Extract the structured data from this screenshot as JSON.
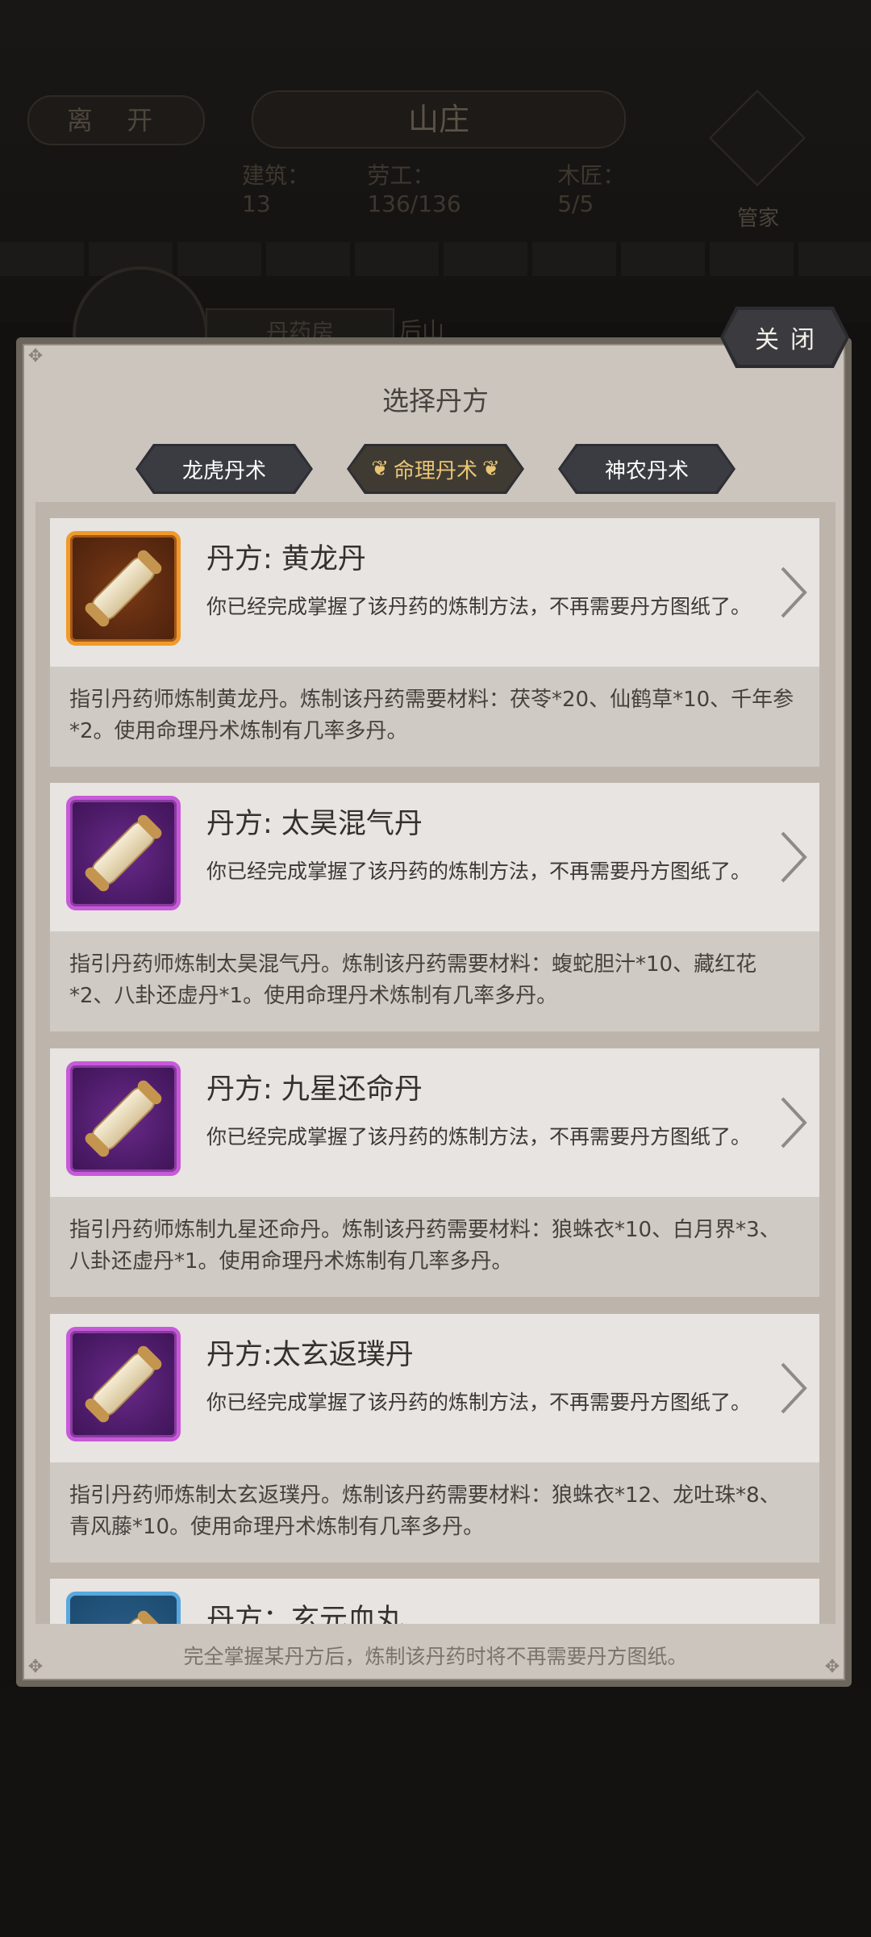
{
  "background": {
    "leave_button": "离 开",
    "location_title": "山庄",
    "stats": [
      "建筑：13",
      "劳工：136/136",
      "木匠：5/5"
    ],
    "manager_label": "管家",
    "tab_pharmacy": "丹药房",
    "tab_next": "后山"
  },
  "dialog": {
    "title": "选择丹方",
    "close_label": "关闭",
    "tabs": [
      {
        "label": "龙虎丹术",
        "active": false
      },
      {
        "label": "命理丹术",
        "active": true
      },
      {
        "label": "神农丹术",
        "active": false
      }
    ],
    "recipes": [
      {
        "name": "丹方: 黄龙丹",
        "status": "你已经完成掌握了该丹药的炼制方法，不再需要丹方图纸了。",
        "description": "指引丹药师炼制黄龙丹。炼制该丹药需要材料：茯苓*20、仙鹤草*10、千年参*2。使用命理丹术炼制有几率多丹。",
        "rarity": "orange"
      },
      {
        "name": "丹方: 太昊混气丹",
        "status": "你已经完成掌握了该丹药的炼制方法，不再需要丹方图纸了。",
        "description": "指引丹药师炼制太昊混气丹。炼制该丹药需要材料：蝮蛇胆汁*10、藏红花*2、八卦还虚丹*1。使用命理丹术炼制有几率多丹。",
        "rarity": "purple"
      },
      {
        "name": "丹方: 九星还命丹",
        "status": "你已经完成掌握了该丹药的炼制方法，不再需要丹方图纸了。",
        "description": "指引丹药师炼制九星还命丹。炼制该丹药需要材料：狼蛛衣*10、白月界*3、八卦还虚丹*1。使用命理丹术炼制有几率多丹。",
        "rarity": "purple"
      },
      {
        "name": "丹方:太玄返璞丹",
        "status": "你已经完成掌握了该丹药的炼制方法，不再需要丹方图纸了。",
        "description": "指引丹药师炼制太玄返璞丹。炼制该丹药需要材料：狼蛛衣*12、龙吐珠*8、青风藤*10。使用命理丹术炼制有几率多丹。",
        "rarity": "purple"
      },
      {
        "name": "丹方：玄元血丸",
        "status": "",
        "description": "",
        "rarity": "blue"
      }
    ],
    "footer_note": "完全掌握某丹方后，炼制该丹药时将不再需要丹方图纸。"
  }
}
